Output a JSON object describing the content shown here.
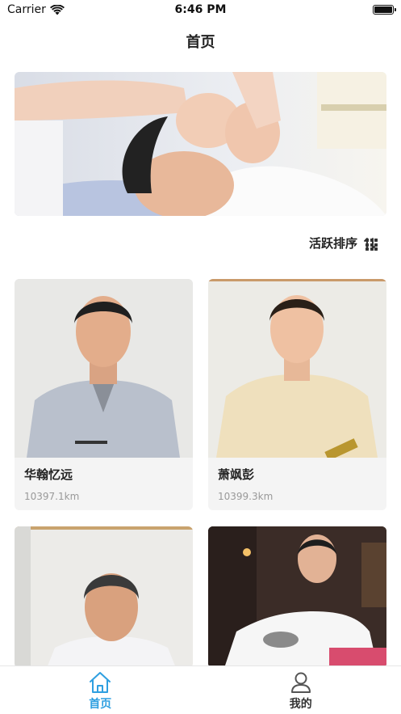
{
  "status_bar": {
    "carrier": "Carrier",
    "time": "6:46 PM"
  },
  "nav": {
    "title": "首页"
  },
  "banner": {
    "image": "facial-massage-photo"
  },
  "sort": {
    "label": "活跃排序",
    "sort_icon": "sort-arrows-icon",
    "view_icon": "grid-view-icon"
  },
  "cards": [
    {
      "name": "华翰忆远",
      "distance": "10397.1km",
      "image": "portrait-man-grey-tangzhuang"
    },
    {
      "name": "萧飒彭",
      "distance": "10399.3km",
      "image": "portrait-man-beige-tangzhuang"
    },
    {
      "name": "",
      "distance": "",
      "image": "portrait-man-white-shirt"
    },
    {
      "name": "",
      "distance": "",
      "image": "portrait-man-moxibustion"
    }
  ],
  "tab_bar": {
    "tabs": [
      {
        "label": "首页",
        "icon": "home-icon",
        "active": true
      },
      {
        "label": "我的",
        "icon": "user-icon",
        "active": false
      }
    ]
  },
  "colors": {
    "accent": "#2e9fe0",
    "card_bg": "#f4f4f4",
    "muted_text": "#999999"
  }
}
